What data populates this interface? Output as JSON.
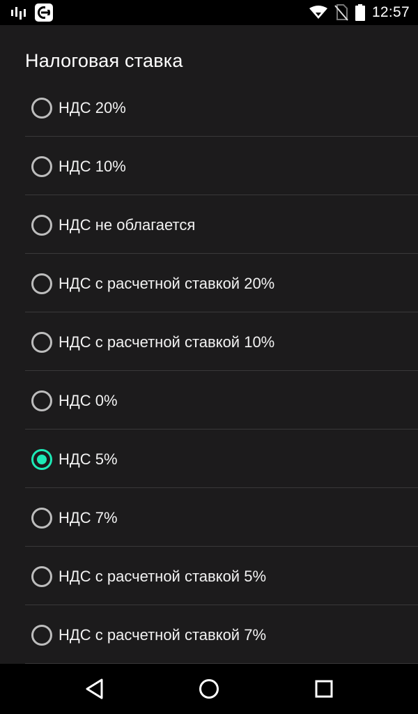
{
  "status_bar": {
    "time": "12:57",
    "left_icons": [
      "audio-bars-icon",
      "app-e-icon"
    ],
    "right_icons": [
      "wifi-icon",
      "no-sim-icon",
      "battery-icon"
    ]
  },
  "dialog": {
    "title": "Налоговая ставка",
    "options": [
      {
        "label": "НДС 20%",
        "checked": false
      },
      {
        "label": "НДС 10%",
        "checked": false
      },
      {
        "label": "НДС не облагается",
        "checked": false
      },
      {
        "label": "НДС с расчетной ставкой 20%",
        "checked": false
      },
      {
        "label": "НДС с расчетной ставкой 10%",
        "checked": false
      },
      {
        "label": "НДС 0%",
        "checked": false
      },
      {
        "label": "НДС 5%",
        "checked": true
      },
      {
        "label": "НДС 7%",
        "checked": false
      },
      {
        "label": "НДС с расчетной ставкой 5%",
        "checked": false
      },
      {
        "label": "НДС с расчетной ставкой 7%",
        "checked": false
      }
    ],
    "selected_value": "НДС 5%"
  },
  "nav_bar": {
    "buttons": [
      "back-icon",
      "home-icon",
      "recents-icon"
    ]
  },
  "colors": {
    "background": "#1c1b1c",
    "accent": "#1de9b6",
    "radio_unchecked": "#bdbdbd",
    "divider": "#3a393a",
    "bars": "#000000"
  }
}
